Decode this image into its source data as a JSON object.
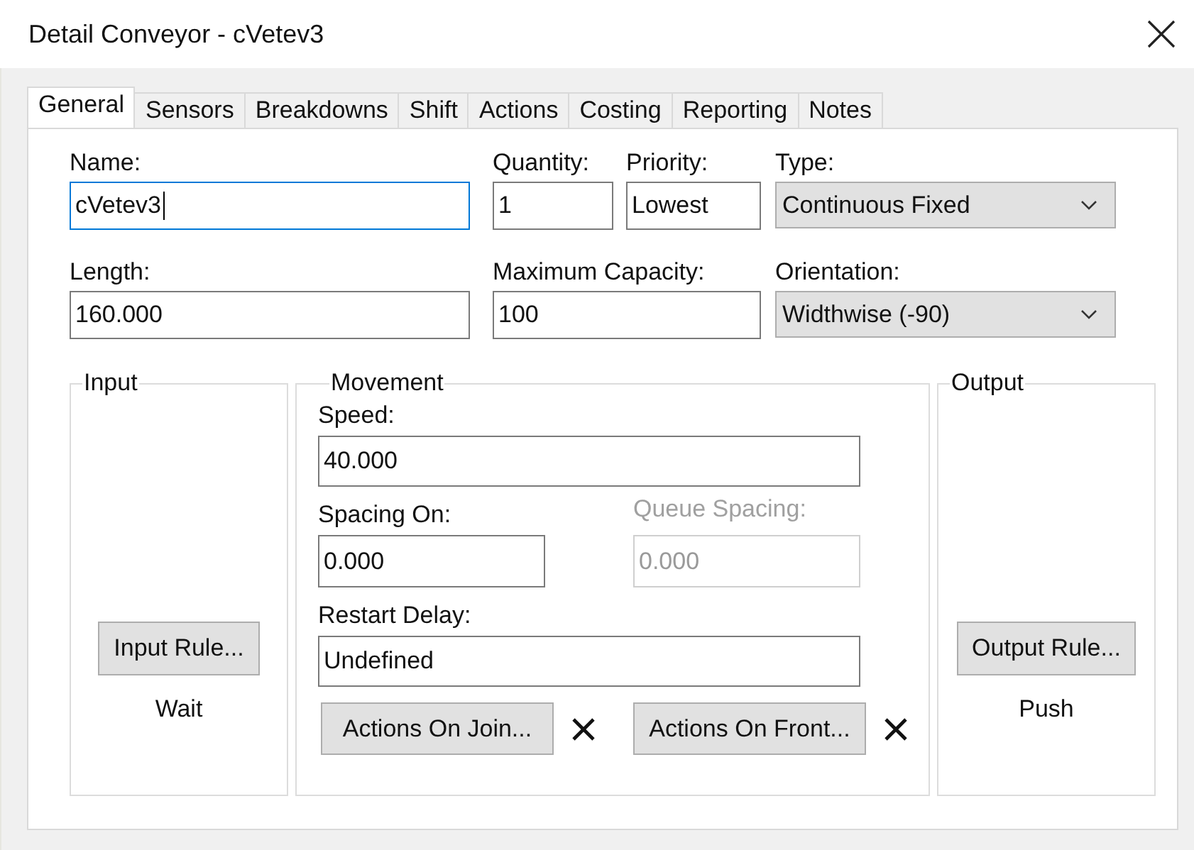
{
  "window": {
    "title": "Detail Conveyor - cVetev3"
  },
  "tabs": [
    {
      "label": "General",
      "selected": true
    },
    {
      "label": "Sensors",
      "selected": false
    },
    {
      "label": "Breakdowns",
      "selected": false
    },
    {
      "label": "Shift",
      "selected": false
    },
    {
      "label": "Actions",
      "selected": false
    },
    {
      "label": "Costing",
      "selected": false
    },
    {
      "label": "Reporting",
      "selected": false
    },
    {
      "label": "Notes",
      "selected": false
    }
  ],
  "fields": [
    {
      "kind": "text",
      "label": "Name:",
      "value": "cVetev3",
      "focused": true
    },
    {
      "kind": "text",
      "label": "Quantity:",
      "value": "1",
      "focused": false
    },
    {
      "kind": "text",
      "label": "Priority:",
      "value": "Lowest",
      "focused": false
    },
    {
      "kind": "select",
      "label": "Type:",
      "value": "Continuous Fixed",
      "focused": false
    },
    {
      "kind": "text",
      "label": "Length:",
      "value": "160.000",
      "focused": false
    },
    {
      "kind": "text",
      "label": "Maximum Capacity:",
      "value": "100",
      "focused": false
    },
    {
      "kind": "select",
      "label": "Orientation:",
      "value": "Widthwise (-90)",
      "focused": false
    }
  ],
  "input_group": {
    "legend": "Input",
    "button": "Input Rule...",
    "value": "Wait"
  },
  "movement_group": {
    "legend": "Movement",
    "fields": [
      {
        "label": "Speed:",
        "value": "40.000",
        "disabled": false
      },
      {
        "label": "Spacing On:",
        "value": "0.000",
        "disabled": false
      },
      {
        "label": "Queue Spacing:",
        "value": "0.000",
        "disabled": true
      },
      {
        "label": "Restart Delay:",
        "value": "Undefined",
        "disabled": false
      }
    ],
    "buttons": [
      {
        "label": "Actions On Join..."
      },
      {
        "label": "Actions On Front..."
      }
    ]
  },
  "output_group": {
    "legend": "Output",
    "button": "Output Rule...",
    "value": "Push"
  }
}
